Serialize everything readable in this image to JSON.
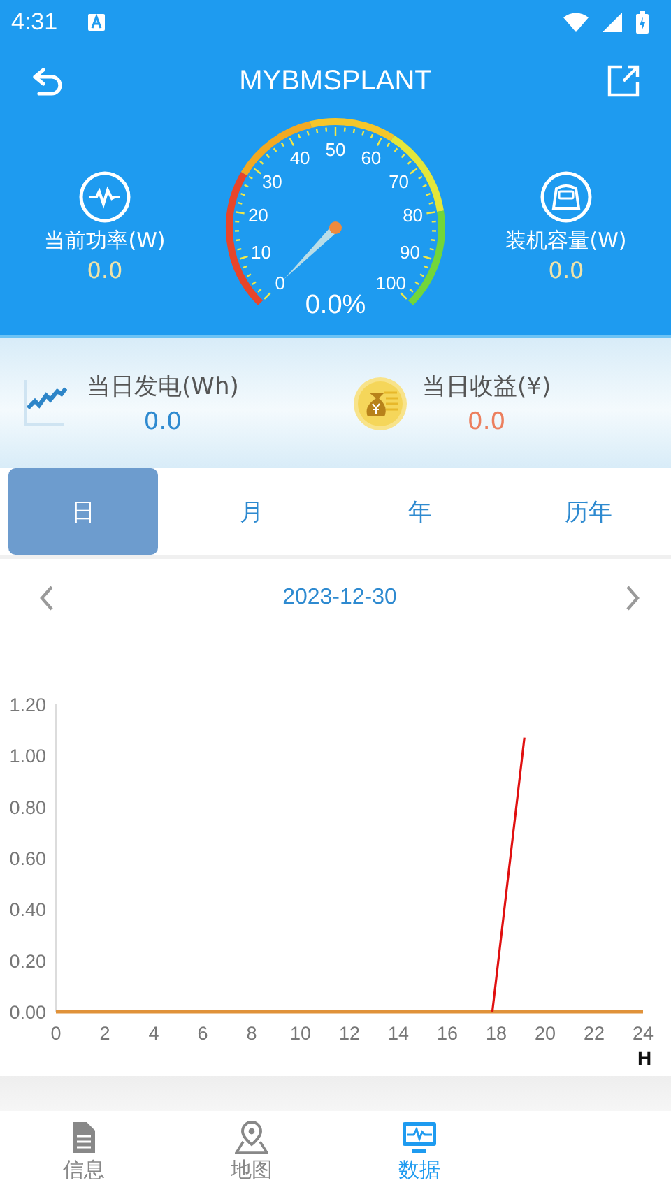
{
  "status_bar": {
    "time": "4:31"
  },
  "header": {
    "title": "MYBMSPLANT"
  },
  "side_stats": [
    {
      "kind": "power",
      "label": "当前功率(W)",
      "value": "0.0"
    },
    {
      "kind": "capacity",
      "label": "装机容量(W)",
      "value": "0.0"
    }
  ],
  "gauge": {
    "reading": "0.0%",
    "scale": [
      "0",
      "10",
      "20",
      "30",
      "40",
      "50",
      "60",
      "70",
      "80",
      "90",
      "100"
    ]
  },
  "summary": [
    {
      "kind": "generation",
      "label": "当日发电(Wh)",
      "value": "0.0"
    },
    {
      "kind": "income",
      "label": "当日收益(¥)",
      "value": "0.0"
    }
  ],
  "period_tabs": [
    {
      "label": "日",
      "selected": true
    },
    {
      "label": "月",
      "selected": false
    },
    {
      "label": "年",
      "selected": false
    },
    {
      "label": "历年",
      "selected": false
    }
  ],
  "date_nav": {
    "date": "2023-12-30"
  },
  "chart": {
    "chart_data": {
      "type": "line",
      "xlabel": "H",
      "x": [
        0,
        2,
        4,
        6,
        8,
        10,
        12,
        14,
        16,
        17.84,
        18,
        19.15,
        20,
        22,
        24
      ],
      "series": [
        {
          "color": "#e0923a",
          "values": [
            0,
            0,
            0,
            0,
            0,
            0,
            0,
            0,
            0,
            0,
            0,
            0,
            0,
            0,
            0
          ]
        },
        {
          "color": "#e01010",
          "values": [
            null,
            null,
            null,
            null,
            null,
            null,
            null,
            null,
            null,
            0,
            0.13,
            1.07,
            null,
            null,
            null
          ]
        }
      ],
      "xlim": [
        0,
        24
      ],
      "ylim": [
        0,
        1.2
      ],
      "xticks": [
        0,
        2,
        4,
        6,
        8,
        10,
        12,
        14,
        16,
        18,
        20,
        22,
        24
      ],
      "yticks": [
        {
          "value": 0,
          "label": "0.00"
        },
        {
          "value": 0.2,
          "label": "0.20"
        },
        {
          "value": 0.4,
          "label": "0.40"
        },
        {
          "value": 0.6,
          "label": "0.60"
        },
        {
          "value": 0.8,
          "label": "0.80"
        },
        {
          "value": 1,
          "label": "1.00"
        },
        {
          "value": 1.2,
          "label": "1.20"
        }
      ]
    }
  },
  "bottom_nav": [
    {
      "kind": "info",
      "label": "信息",
      "selected": false
    },
    {
      "kind": "map",
      "label": "地图",
      "selected": false
    },
    {
      "kind": "data",
      "label": "数据",
      "selected": true
    }
  ]
}
